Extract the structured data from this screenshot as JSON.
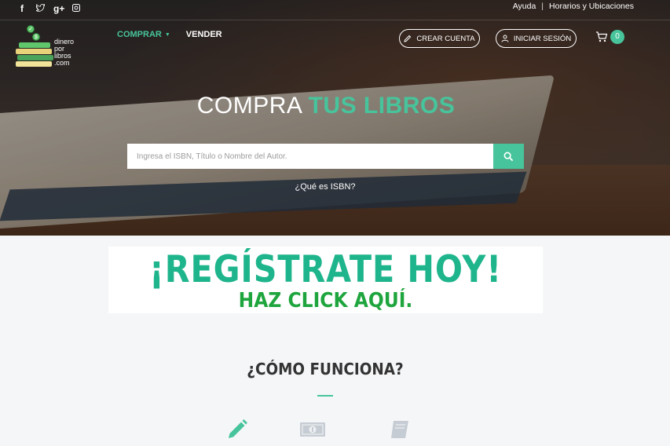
{
  "topbar": {
    "social_icons": [
      "facebook-icon",
      "twitter-icon",
      "google-plus-icon",
      "instagram-icon"
    ],
    "links": [
      "Ayuda",
      "Horarios y Ubicaciones"
    ],
    "separator": "|"
  },
  "logo": {
    "line1": "dinero",
    "line2": "por",
    "line3": "libros",
    "line4": ".com"
  },
  "nav": {
    "buy": "COMPRAR",
    "sell": "VENDER"
  },
  "header_actions": {
    "create_account": "CREAR CUENTA",
    "login": "INICIAR SESIÓN",
    "cart_count": "0"
  },
  "hero": {
    "title_plain": "COMPRA ",
    "title_accent": "TUS LIBROS",
    "search_placeholder": "Ingresa el ISBN, Título o Nombre del Autor.",
    "isbn_link": "¿Qué es ISBN?"
  },
  "banner": {
    "headline": "¡REGÍSTRATE HOY!",
    "subline": "HAZ CLICK AQUÍ."
  },
  "how_it_works": {
    "title": "¿CÓMO FUNCIONA?",
    "step_icons": [
      "pencil-icon",
      "banknote-icon",
      "book-icon"
    ]
  },
  "colors": {
    "accent": "#47c49b",
    "banner_green": "#1fb58c",
    "banner_dark_green": "#1fa53d"
  }
}
